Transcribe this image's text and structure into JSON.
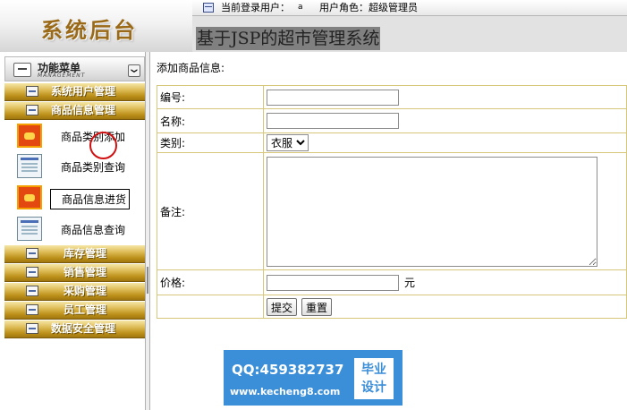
{
  "header": {
    "logo_title": "系统后台",
    "current_user_label": "当前登录用户：",
    "current_user_value": "a",
    "role_text": "用户角色：超级管理员",
    "system_title": "基于JSP的超市管理系统"
  },
  "sidebar": {
    "menu_title": "功能菜单",
    "menu_subtitle": "MANAGEMENT",
    "collapse_glyph": "❯",
    "categories": [
      {
        "label": "系统用户管理"
      },
      {
        "label": "商品信息管理"
      },
      {
        "label": "库存管理"
      },
      {
        "label": "销售管理"
      },
      {
        "label": "采购管理"
      },
      {
        "label": "员工管理"
      },
      {
        "label": "数据安全管理"
      }
    ],
    "subitems": [
      {
        "label": "商品类别添加",
        "icon": "add-form-icon"
      },
      {
        "label": "商品类别查询",
        "icon": "query-list-icon"
      },
      {
        "label": "商品信息进货",
        "icon": "add-form-icon",
        "active": true
      },
      {
        "label": "商品信息查询",
        "icon": "query-list-icon"
      }
    ]
  },
  "main": {
    "heading": "添加商品信息:",
    "form": {
      "id_label": "编号:",
      "id_value": "",
      "name_label": "名称:",
      "name_value": "",
      "category_label": "类别:",
      "category_selected": "衣服",
      "notes_label": "备注:",
      "notes_value": "",
      "price_label": "价格:",
      "price_value": "",
      "price_unit": "元",
      "submit_label": "提交",
      "reset_label": "重置"
    }
  },
  "watermark": {
    "qq": "QQ:459382737",
    "site": "www.kecheng8.com",
    "badge_line1": "毕业",
    "badge_line2": "设计"
  },
  "colors": {
    "header_bg": "#e2e2e2",
    "logo_text": "#9a6a18",
    "category_bar": "#c39a2a",
    "table_border": "#d6c77a",
    "watermark_bg": "#3b8ed8"
  }
}
